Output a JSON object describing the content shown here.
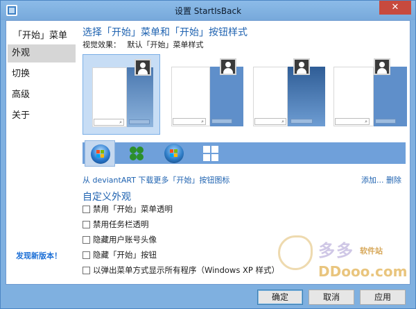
{
  "window": {
    "title": "设置 StartIsBack",
    "close_glyph": "✕"
  },
  "sidebar": {
    "title": "「开始」菜单",
    "items": [
      {
        "label": "外观",
        "selected": true
      },
      {
        "label": "切换",
        "selected": false
      },
      {
        "label": "高级",
        "selected": false
      },
      {
        "label": "关于",
        "selected": false
      }
    ],
    "new_version_link": "发现新版本！"
  },
  "main": {
    "section_title": "选择「开始」菜单和「开始」按钮样式",
    "visual_effect_label": "视觉效果：",
    "visual_effect_value": "默认「开始」菜单样式",
    "menu_styles": [
      {
        "selected": true
      },
      {
        "selected": false
      },
      {
        "selected": false
      },
      {
        "selected": false
      }
    ],
    "orb_buttons": [
      {
        "icon": "windows7-orb-icon",
        "selected": true
      },
      {
        "icon": "clover-orb-icon",
        "selected": false
      },
      {
        "icon": "colored-windows-orb-icon",
        "selected": false
      },
      {
        "icon": "windows8-logo-icon",
        "selected": false
      }
    ],
    "more_link": "从 deviantART 下载更多「开始」按钮图标",
    "add_link": "添加...",
    "delete_link": "删除",
    "custom_title": "自定义外观",
    "options": [
      {
        "label": "禁用「开始」菜单透明",
        "checked": false
      },
      {
        "label": "禁用任务栏透明",
        "checked": false
      },
      {
        "label": "隐藏用户账号头像",
        "checked": false
      },
      {
        "label": "隐藏「开始」按钮",
        "checked": false
      },
      {
        "label": "以弹出菜单方式显示所有程序（Windows XP 样式）",
        "checked": false
      }
    ]
  },
  "footer": {
    "ok": "确定",
    "cancel": "取消",
    "apply": "应用"
  },
  "watermark": {
    "cn": "多多",
    "sub": "软件站",
    "domain": "DDooo.com"
  },
  "colors": {
    "accent": "#1e62b0",
    "titlebar": "#7fb0e0",
    "close": "#c74a3e"
  }
}
